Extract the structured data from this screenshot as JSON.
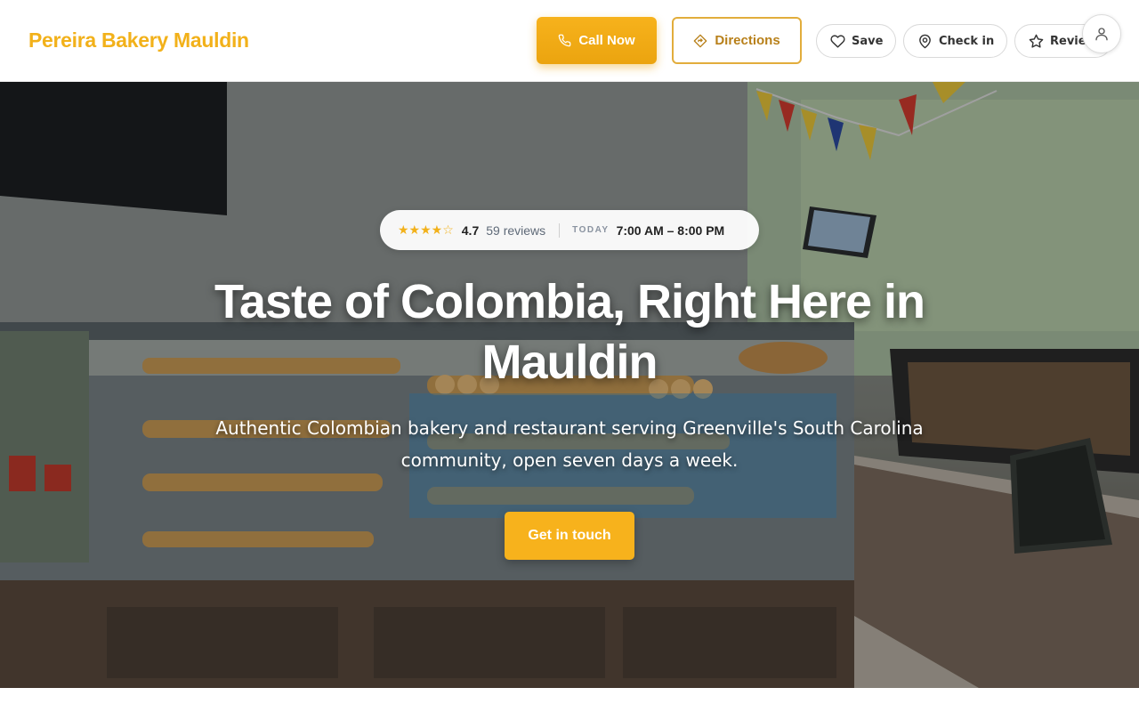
{
  "header": {
    "brand": "Pereira Bakery Mauldin",
    "call_label": "Call Now",
    "directions_label": "Directions",
    "save_label": "Save",
    "checkin_label": "Check in",
    "review_label": "Review"
  },
  "hero": {
    "stars": "★★★★☆",
    "rating": "4.7",
    "reviews": "59 reviews",
    "today_label": "TODAY",
    "hours": "7:00 AM – 8:00 PM",
    "headline": "Taste of Colombia, Right Here in Mauldin",
    "subtitle": "Authentic Colombian bakery and restaurant serving Greenville's South Carolina community, open seven days a week.",
    "cta_label": "Get in touch"
  },
  "icons": {
    "call": "phone-icon",
    "directions": "directions-icon",
    "save": "heart-icon",
    "checkin": "map-pin-icon",
    "review": "star-icon",
    "account": "user-icon"
  },
  "colors": {
    "accent": "#f2b11a",
    "accent_dark": "#b8801a",
    "text_dark": "#222222"
  }
}
